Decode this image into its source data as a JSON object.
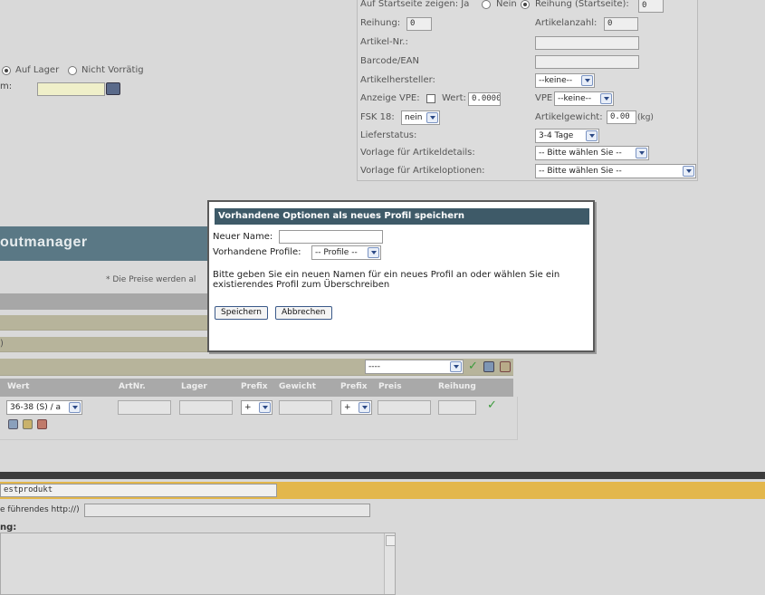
{
  "right_panel": {
    "startseite_label": "Auf Startseite zeigen: Ja",
    "startseite_nein": "Nein",
    "reihung_startseite_label": "Reihung (Startseite):",
    "reihung_startseite_value": "0",
    "reihung_label": "Reihung:",
    "reihung_value": "0",
    "artikelanzahl_label": "Artikelanzahl:",
    "artikelanzahl_value": "0",
    "artikelnr_label": "Artikel-Nr.:",
    "barcode_label": "Barcode/EAN",
    "hersteller_label": "Artikelhersteller:",
    "hersteller_value": "--keine--",
    "vpe_label": "Anzeige VPE:",
    "wert_label": "Wert:",
    "wert_value": "0.0000",
    "vpe2_label": "VPE",
    "vpe2_value": "--keine--",
    "fsk_label": "FSK 18:",
    "fsk_value": "nein",
    "gewicht_label": "Artikelgewicht:",
    "gewicht_value": "0.00",
    "gewicht_unit": "(kg)",
    "lieferstatus_label": "Lieferstatus:",
    "lieferstatus_value": "3-4 Tage",
    "vorlage_details_label": "Vorlage für Artikeldetails:",
    "vorlage_details_value": "-- Bitte wählen Sie --",
    "vorlage_optionen_label": "Vorlage für Artikeloptionen:",
    "vorlage_optionen_value": "-- Bitte wählen Sie --"
  },
  "left_panel": {
    "auf_lager": "Auf Lager",
    "nicht_vorraetig": "Nicht Vorrätig",
    "datum_label": "m:"
  },
  "section": {
    "title": "outmanager",
    "price_note": "* Die Preise werden al",
    "row_text": ")",
    "option_select": "----"
  },
  "table": {
    "headers": [
      "Wert",
      "ArtNr.",
      "Lager",
      "Prefix",
      "Gewicht",
      "Prefix",
      "Preis",
      "Reihung"
    ],
    "wert_value": "36-38 (S) / a",
    "prefix1": "+",
    "prefix2": "+"
  },
  "dialog": {
    "title": "Vorhandene Optionen als neues Profil speichern",
    "name_label": "Neuer Name:",
    "profile_label": "Vorhandene Profile:",
    "profile_value": "-- Profile --",
    "message": "Bitte geben Sie ein neuen Namen für ein neues Profil an oder wählen Sie ein existierendes Profil zum Überschreiben",
    "save_label": "Speichern",
    "cancel_label": "Abbrechen"
  },
  "bottom": {
    "product_name": "estprodukt",
    "url_label": "e führendes http://)",
    "desc_label": "ng:"
  }
}
